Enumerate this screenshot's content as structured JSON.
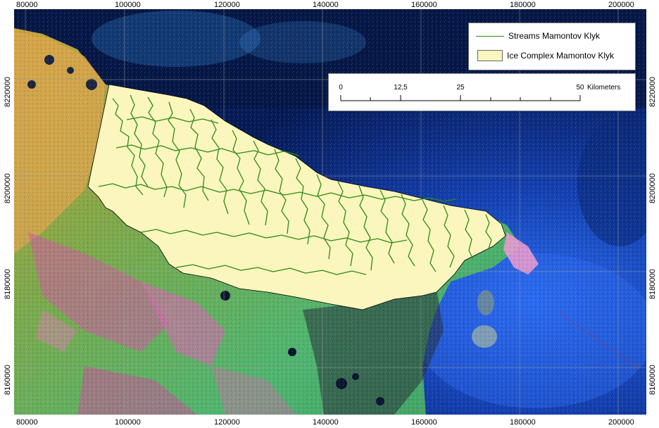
{
  "map": {
    "x_ticks": [
      "80000",
      "100000",
      "120000",
      "140000",
      "160000",
      "180000",
      "200000"
    ],
    "y_ticks": [
      "8220000",
      "8200000",
      "8180000",
      "8160000"
    ],
    "tick_decimals": "000000000",
    "colors": {
      "sea_deep": "#04112e",
      "sea_mid": "#0e2f8e",
      "sea_shallow": "#1f5fe0",
      "ice_complex_fill": "#fbf6be",
      "ice_complex_outline": "#000000",
      "stream": "#2e8b14",
      "tundra_green": "#3fa05a",
      "tundra_pink": "#d35aa5",
      "tundra_orange": "#e2a24c"
    }
  },
  "legend": {
    "items": [
      {
        "label": "Streams Mamontov Klyk",
        "symbol": "line"
      },
      {
        "label": "Ice Complex Mamontov Klyk",
        "symbol": "fill"
      }
    ]
  },
  "scalebar": {
    "labels": [
      "0",
      "12,5",
      "25",
      "50"
    ],
    "unit": "Kilometers"
  }
}
